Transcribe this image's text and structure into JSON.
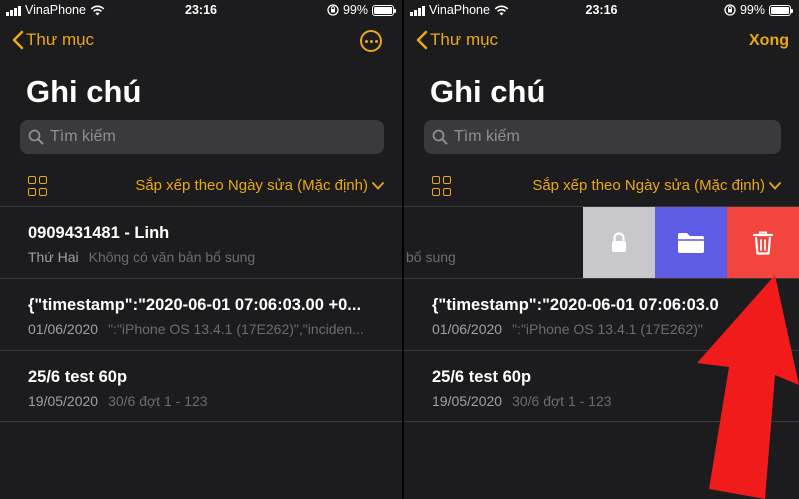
{
  "status": {
    "carrier": "VinaPhone",
    "time": "23:16",
    "battery": "99%",
    "battery_level": 0.99
  },
  "nav": {
    "back_label": "Thư mục",
    "done_label": "Xong"
  },
  "title": "Ghi chú",
  "search": {
    "placeholder": "Tìm kiếm"
  },
  "sort": {
    "label": "Sắp xếp theo Ngày sửa (Mặc định)"
  },
  "notes": [
    {
      "title": "0909431481 - Linh",
      "date": "Thứ Hai",
      "preview": "Không có văn bản bổ sung"
    },
    {
      "title": "{\"timestamp\":\"2020-06-01 07:06:03.00 +0...",
      "date": "01/06/2020",
      "preview": "\":\"iPhone OS 13.4.1 (17E262)\",\"inciden..."
    },
    {
      "title": "25/6 test 60p",
      "date": "19/05/2020",
      "preview": "30/6 đợt 1 - 123"
    }
  ],
  "right_notes": [
    {
      "title": "",
      "preview": "bổ sung"
    },
    {
      "title": "{\"timestamp\":\"2020-06-01 07:06:03.0",
      "date": "01/06/2020",
      "preview": "\":\"iPhone OS 13.4.1 (17E262)\""
    },
    {
      "title": "25/6 test 60p",
      "date": "19/05/2020",
      "preview": "30/6 đợt 1 - 123"
    }
  ],
  "colors": {
    "accent": "#e9a819",
    "background": "#1c1c1e",
    "lock": "#c7c7cc",
    "folder": "#5e5ce6",
    "delete": "#f2453d",
    "arrow": "#f21b1b"
  },
  "icons": [
    "signal-icon",
    "wifi-icon",
    "orientation-lock-icon",
    "battery-icon",
    "chevron-left-icon",
    "ellipsis-circle-icon",
    "search-icon",
    "grid-icon",
    "chevron-down-icon",
    "lock-icon",
    "folder-icon",
    "trash-icon",
    "arrow-icon"
  ]
}
